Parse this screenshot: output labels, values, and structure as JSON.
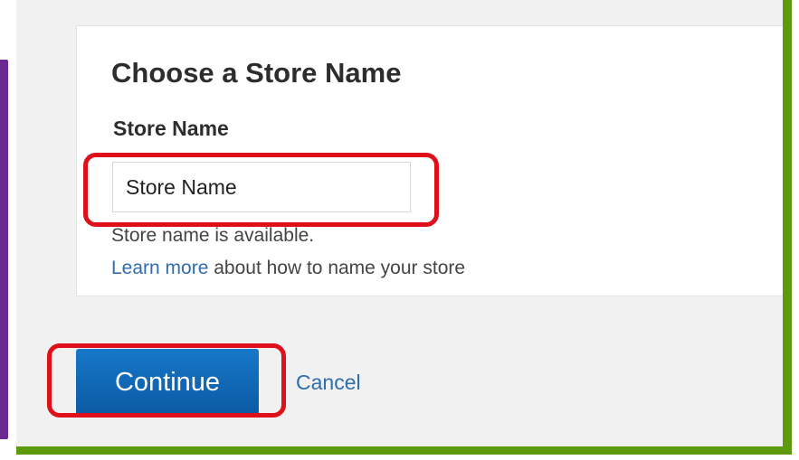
{
  "colors": {
    "panel_background": "#f1f1f1",
    "card_background": "#ffffff",
    "left_accent": "#6b2a8f",
    "frame_accent": "#5e9a0e",
    "primary_button": "#0a5aa3",
    "link": "#2f6dad",
    "highlight": "#e0101b"
  },
  "store_form": {
    "title": "Choose a Store Name",
    "field_label": "Store Name",
    "input_value": "Store Name",
    "input_placeholder": "Store Name",
    "availability_message": "Store name is available.",
    "learn_more_link": "Learn more",
    "learn_more_suffix": " about how to name your store"
  },
  "actions": {
    "continue_label": "Continue",
    "cancel_label": "Cancel"
  }
}
